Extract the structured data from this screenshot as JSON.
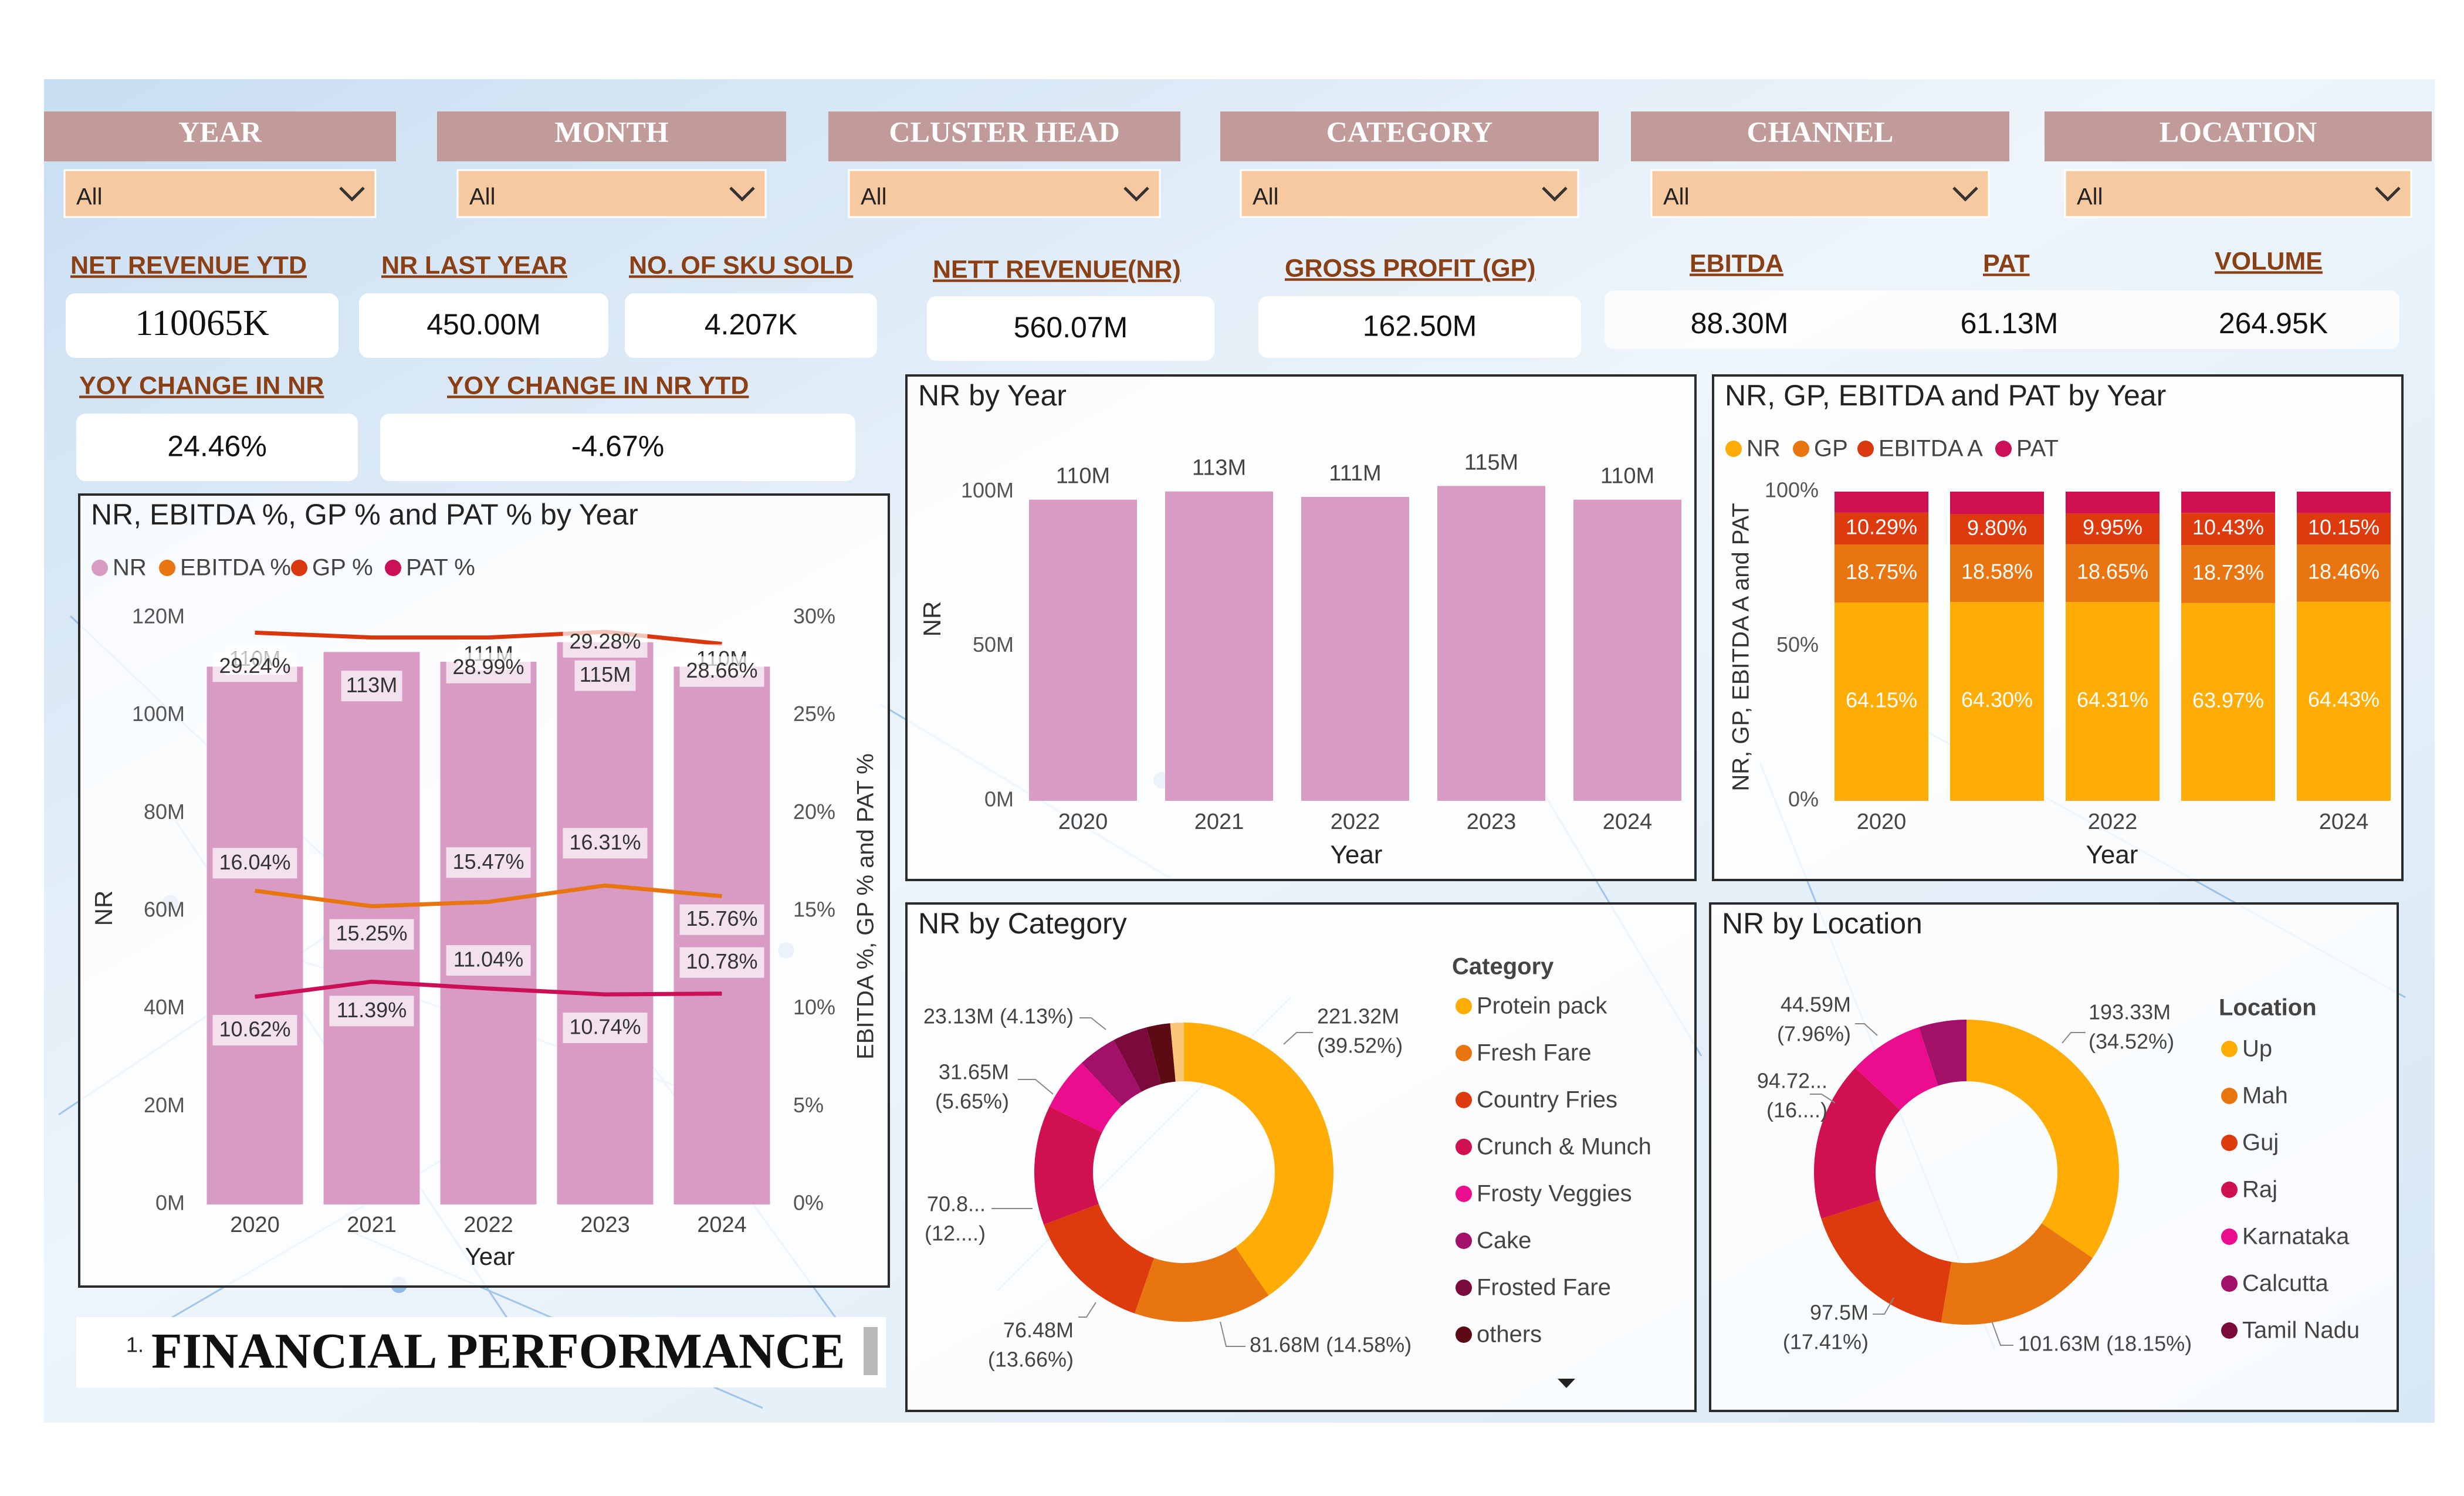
{
  "filters": [
    {
      "label": "YEAR",
      "value": "All"
    },
    {
      "label": "MONTH",
      "value": "All"
    },
    {
      "label": "CLUSTER HEAD",
      "value": "All"
    },
    {
      "label": "CATEGORY",
      "value": "All"
    },
    {
      "label": "CHANNEL",
      "value": "All"
    },
    {
      "label": "LOCATION",
      "value": "All"
    }
  ],
  "kpis": [
    {
      "label": "NET REVENUE YTD",
      "value": "110065K"
    },
    {
      "label": "NR LAST YEAR",
      "value": "450.00M"
    },
    {
      "label": "NO. OF SKU SOLD",
      "value": "4.207K"
    },
    {
      "label": "NETT REVENUE(NR)",
      "value": "560.07M"
    },
    {
      "label": "GROSS PROFIT (GP)",
      "value": "162.50M"
    },
    {
      "label": "EBITDA",
      "value": "88.30M"
    },
    {
      "label": "PAT",
      "value": "61.13M"
    },
    {
      "label": "VOLUME",
      "value": "264.95K"
    },
    {
      "label": "YOY  CHANGE IN NR",
      "value": "24.46%"
    },
    {
      "label": "YOY  CHANGE IN NR YTD",
      "value": "-4.67%"
    }
  ],
  "page_title": {
    "number": "1.",
    "text": "FINANCIAL PERFORMANCE"
  },
  "colors": {
    "nr_pink": "#d89cc4",
    "ebitda_orange": "#e8750f",
    "gp_redorange": "#d9380f",
    "pat_crimson": "#cc1058",
    "filter_header": "#c19a9a",
    "filter_box": "#f7c9a0",
    "kpi_label": "#8b3f14",
    "donut": [
      "#ffad05",
      "#e8750f",
      "#dd3a0e",
      "#d1104f",
      "#ec0d8e",
      "#a3106a",
      "#7a0a3c",
      "#5c0a14",
      "#f9c67a"
    ]
  },
  "chart_data": [
    {
      "id": "combo",
      "type": "bar",
      "title": "NR, EBITDA %, GP % and PAT % by Year",
      "legend": [
        "NR",
        "EBITDA %",
        "GP %",
        "PAT %"
      ],
      "categories": [
        "2020",
        "2021",
        "2022",
        "2023",
        "2024"
      ],
      "xlabel": "Year",
      "ylabel": "NR",
      "y2label": "EBITDA %, GP % and PAT %",
      "ylim": [
        0,
        120
      ],
      "y_ticks": [
        "0M",
        "20M",
        "40M",
        "60M",
        "80M",
        "100M",
        "120M"
      ],
      "y2lim": [
        0,
        30
      ],
      "y2_ticks": [
        "0%",
        "5%",
        "10%",
        "15%",
        "20%",
        "25%",
        "30%"
      ],
      "series": [
        {
          "name": "NR",
          "values": [
            110,
            113,
            111,
            115,
            110
          ],
          "labels": [
            "110M",
            "113M",
            "111M",
            "115M",
            "110M"
          ]
        },
        {
          "name": "EBITDA %",
          "values": [
            16.04,
            15.25,
            15.47,
            16.31,
            15.76
          ],
          "labels": [
            "16.04%",
            "15.25%",
            "15.47%",
            "16.31%",
            "15.76%"
          ]
        },
        {
          "name": "GP %",
          "values": [
            29.24,
            28.99,
            28.99,
            29.28,
            28.66
          ],
          "labels": [
            "29.24%",
            "",
            "28.99%",
            "29.28%",
            "28.66%"
          ]
        },
        {
          "name": "PAT %",
          "values": [
            10.62,
            11.39,
            11.04,
            10.74,
            10.78
          ],
          "labels": [
            "10.62%",
            "11.39%",
            "11.04%",
            "10.74%",
            "10.78%"
          ]
        }
      ]
    },
    {
      "id": "nrbar",
      "type": "bar",
      "title": "NR by Year",
      "categories": [
        "2020",
        "2021",
        "2022",
        "2023",
        "2024"
      ],
      "values": [
        110,
        113,
        111,
        115,
        110
      ],
      "labels": [
        "110M",
        "113M",
        "111M",
        "115M",
        "110M"
      ],
      "xlabel": "Year",
      "ylabel": "NR",
      "ylim": [
        0,
        120
      ],
      "y_ticks": [
        "0M",
        "50M",
        "100M"
      ]
    },
    {
      "id": "stacked",
      "type": "bar",
      "title": "NR, GP, EBITDA and PAT by Year",
      "legend": [
        "NR",
        "GP",
        "EBITDA A",
        "PAT"
      ],
      "categories": [
        "2020",
        "2021",
        "2022",
        "2023",
        "2024"
      ],
      "x_ticks": [
        "2020",
        "",
        "2022",
        "",
        "2024"
      ],
      "xlabel": "Year",
      "ylabel": "NR, GP, EBITDA A and PAT",
      "ylim": [
        0,
        100
      ],
      "y_ticks": [
        "0%",
        "50%",
        "100%"
      ],
      "series": [
        {
          "name": "NR",
          "values": [
            64.15,
            64.3,
            64.31,
            63.97,
            64.43
          ]
        },
        {
          "name": "GP",
          "values": [
            18.75,
            18.58,
            18.65,
            18.73,
            18.46
          ]
        },
        {
          "name": "EBITDA A",
          "values": [
            10.29,
            9.8,
            9.95,
            10.43,
            10.15
          ]
        },
        {
          "name": "PAT",
          "values": [
            6.81,
            7.32,
            7.09,
            6.87,
            6.96
          ]
        }
      ],
      "segment_labels": [
        [
          "64.15%",
          "18.75%",
          "10.29%"
        ],
        [
          "64.30%",
          "18.58%",
          "9.80%"
        ],
        [
          "64.31%",
          "18.65%",
          "9.95%"
        ],
        [
          "63.97%",
          "18.73%",
          "10.43%"
        ],
        [
          "64.43%",
          "18.46%",
          "10.15%"
        ]
      ]
    },
    {
      "id": "cat",
      "type": "pie",
      "title": "NR by Category",
      "legend_title": "Category",
      "categories": [
        "Protein pack",
        "Fresh Fare",
        "Country Fries",
        "Crunch & Munch",
        "Frosty Veggies",
        "Cake",
        "Frosted Fare",
        "others"
      ],
      "values": [
        221.32,
        81.68,
        76.48,
        70.8,
        31.65,
        23.13,
        20.5,
        14.0,
        8.0
      ],
      "labels": [
        [
          "221.32M",
          "(39.52%)"
        ],
        [
          "81.68M (14.58%)"
        ],
        [
          "76.48M",
          "(13.66%)"
        ],
        [
          "70.8...",
          "(12....)"
        ],
        [
          "31.65M",
          "(5.65%)"
        ],
        [
          "23.13M (4.13%)"
        ]
      ]
    },
    {
      "id": "loc",
      "type": "pie",
      "title": "NR by Location",
      "legend_title": "Location",
      "categories": [
        "Up",
        "Mah",
        "Guj",
        "Raj",
        "Karnataka",
        "Calcutta",
        "Tamil Nadu"
      ],
      "values": [
        193.33,
        101.63,
        97.5,
        94.72,
        44.59,
        28.3
      ],
      "labels": [
        [
          "193.33M",
          "(34.52%)"
        ],
        [
          "101.63M (18.15%)"
        ],
        [
          "97.5M",
          "(17.41%)"
        ],
        [
          "94.72...",
          "(16....)"
        ],
        [
          "44.59M",
          "(7.96%)"
        ]
      ]
    }
  ]
}
